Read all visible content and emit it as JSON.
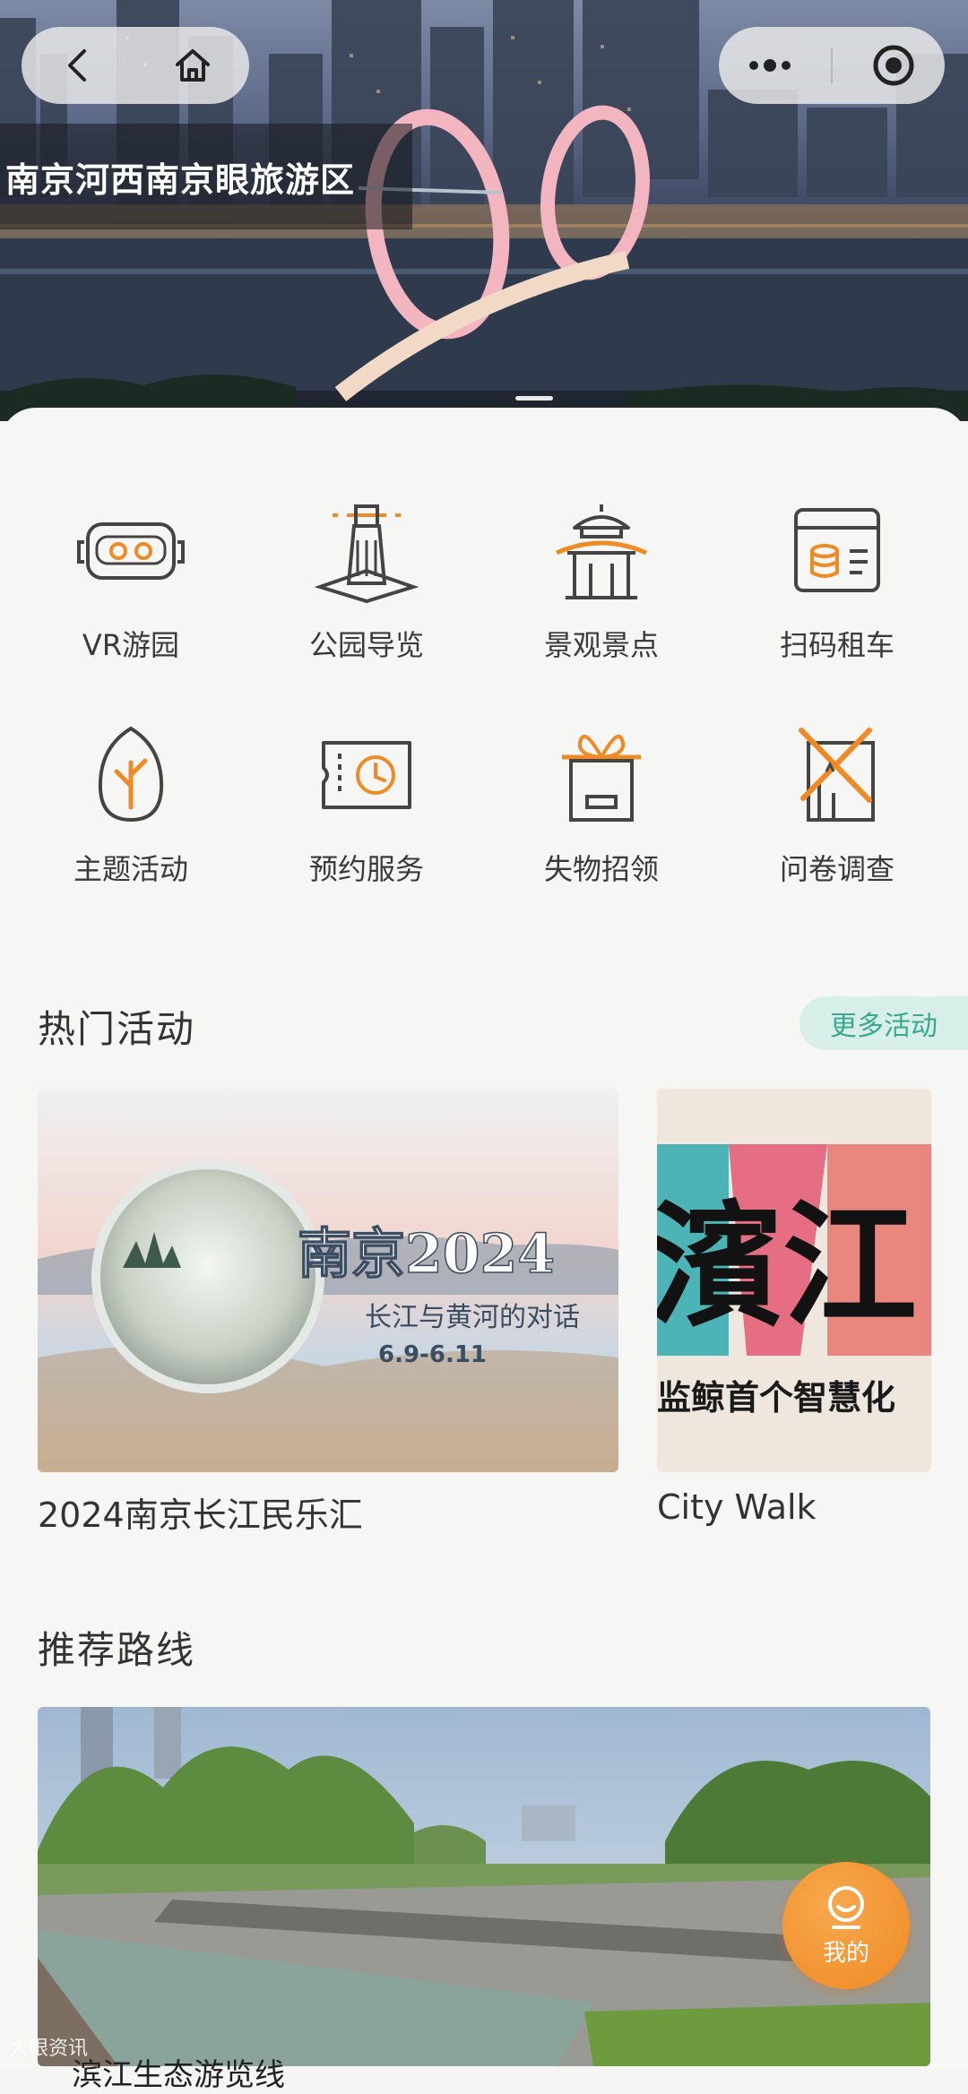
{
  "hero": {
    "title": "南京河西南京眼旅游区"
  },
  "nav": {
    "back_icon": "back-arrow-icon",
    "home_icon": "home-icon",
    "more_icon": "more-dots-icon",
    "close_icon": "close-target-icon"
  },
  "services": [
    {
      "label": "VR游园",
      "icon": "vr-headset-icon"
    },
    {
      "label": "公园导览",
      "icon": "lighthouse-icon"
    },
    {
      "label": "景观景点",
      "icon": "pavilion-icon"
    },
    {
      "label": "扫码租车",
      "icon": "scan-rent-icon"
    },
    {
      "label": "主题活动",
      "icon": "egg-branch-icon"
    },
    {
      "label": "预约服务",
      "icon": "ticket-clock-icon"
    },
    {
      "label": "失物招领",
      "icon": "gift-box-icon"
    },
    {
      "label": "问卷调查",
      "icon": "survey-icon"
    }
  ],
  "hot_activities": {
    "title": "热门活动",
    "more_label": "更多活动",
    "cards": [
      {
        "caption": "2024南京长江民乐汇",
        "poster_text": "长江与黄河的对话",
        "poster_brand": "南京2024",
        "poster_date": "6.9-6.11"
      },
      {
        "caption": "City Walk",
        "poster_text": "濱江",
        "poster_sub": "监鲸首个智慧化"
      }
    ]
  },
  "routes": {
    "title": "推荐路线",
    "bottom_text": "滨江生态游览线"
  },
  "fab": {
    "label": "我的"
  },
  "colors": {
    "accent_orange": "#ef8a24",
    "icon_dark": "#444444",
    "teal": "#3aa890"
  },
  "watermark": "大眼资讯"
}
